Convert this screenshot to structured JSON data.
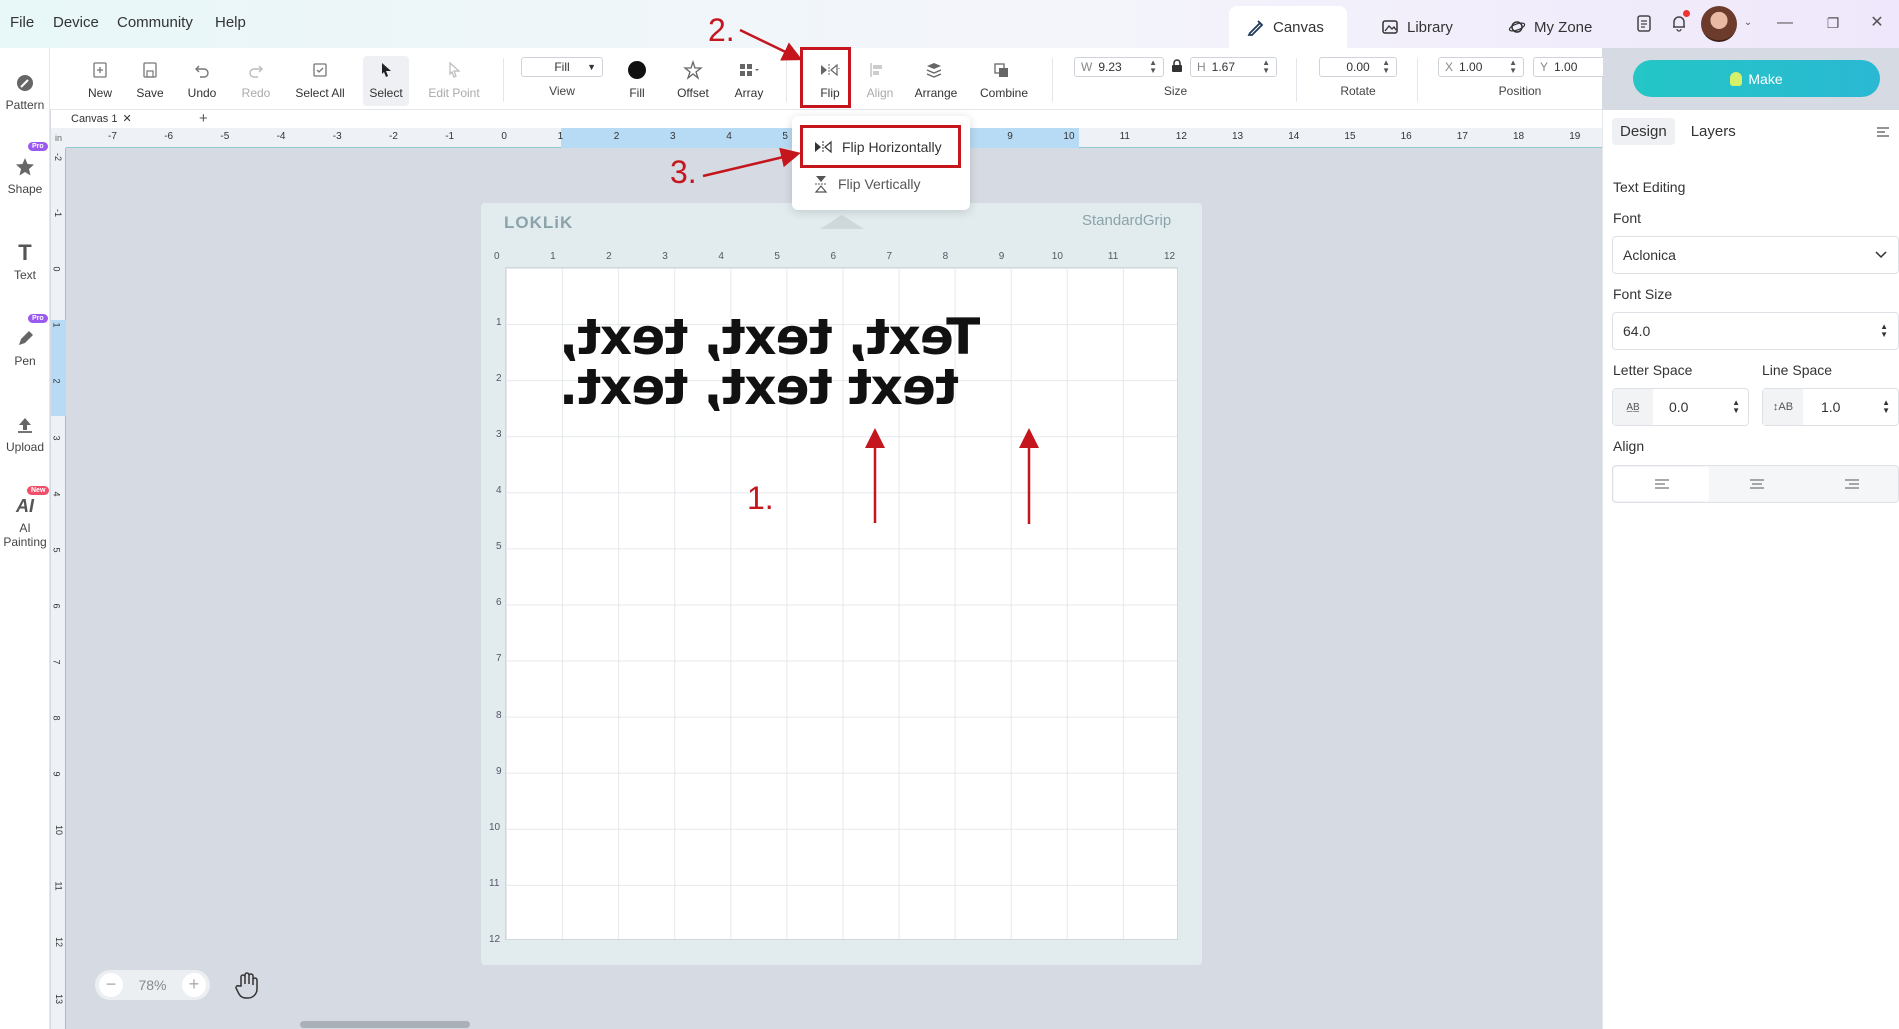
{
  "menu": {
    "file": "File",
    "device": "Device",
    "community": "Community",
    "help": "Help"
  },
  "top_tabs": {
    "canvas": "Canvas",
    "library": "Library",
    "myzone": "My Zone"
  },
  "toolbar": {
    "new": "New",
    "save": "Save",
    "undo": "Undo",
    "redo": "Redo",
    "select_all": "Select All",
    "select": "Select",
    "edit_point": "Edit Point",
    "view_value": "Fill",
    "view": "View",
    "fill": "Fill",
    "offset": "Offset",
    "array": "Array",
    "flip": "Flip",
    "align": "Align",
    "arrange": "Arrange",
    "combine": "Combine",
    "w_prefix": "W",
    "w_value": "9.23",
    "h_prefix": "H",
    "h_value": "1.67",
    "size": "Size",
    "rotate_value": "0.00",
    "rotate": "Rotate",
    "x_prefix": "X",
    "x_value": "1.00",
    "y_prefix": "Y",
    "y_value": "1.00",
    "position": "Position",
    "make": "Make"
  },
  "sidebar": {
    "pattern": "Pattern",
    "shape": "Shape",
    "text": "Text",
    "pen": "Pen",
    "upload": "Upload",
    "ai1": "AI",
    "ai2": "Painting",
    "pro": "Pro",
    "new": "New"
  },
  "canvas_tab": {
    "label": "Canvas 1",
    "close": "✕",
    "add": "+"
  },
  "ruler": {
    "unit": "in",
    "h": [
      "-7",
      "-6",
      "-5",
      "-4",
      "-3",
      "-2",
      "-1",
      "0",
      "1",
      "2",
      "3",
      "4",
      "5",
      "6",
      "7",
      "8",
      "9",
      "10",
      "11",
      "12",
      "13",
      "14",
      "15",
      "16",
      "17",
      "18",
      "19"
    ],
    "v": [
      "-2",
      "-1",
      "0",
      "1",
      "2",
      "3",
      "4",
      "5",
      "6",
      "7",
      "8",
      "9",
      "10",
      "11",
      "12",
      "13"
    ]
  },
  "mat": {
    "logo": "LOKLiK",
    "type": "StandardGrip",
    "h": [
      "0",
      "1",
      "2",
      "3",
      "4",
      "5",
      "6",
      "7",
      "8",
      "9",
      "10",
      "11",
      "12"
    ],
    "v": [
      "1",
      "2",
      "3",
      "4",
      "5",
      "6",
      "7",
      "8",
      "9",
      "10",
      "11",
      "12"
    ]
  },
  "design_text": "Text, text, text, text text, text.",
  "annotations": {
    "step1": "1.",
    "step2": "2.",
    "step3": "3."
  },
  "flip_menu": {
    "horizontal": "Flip Horizontally",
    "vertical": "Flip Vertically"
  },
  "zoom": {
    "minus": "−",
    "value": "78%",
    "plus": "+"
  },
  "panel": {
    "tab_design": "Design",
    "tab_layers": "Layers",
    "section": "Text Editing",
    "font_label": "Font",
    "font_value": "Aclonica",
    "font_size_label": "Font Size",
    "font_size_value": "64.0",
    "letter_space_label": "Letter Space",
    "letter_space_value": "0.0",
    "line_space_label": "Line Space",
    "line_space_value": "1.0",
    "align_label": "Align"
  }
}
